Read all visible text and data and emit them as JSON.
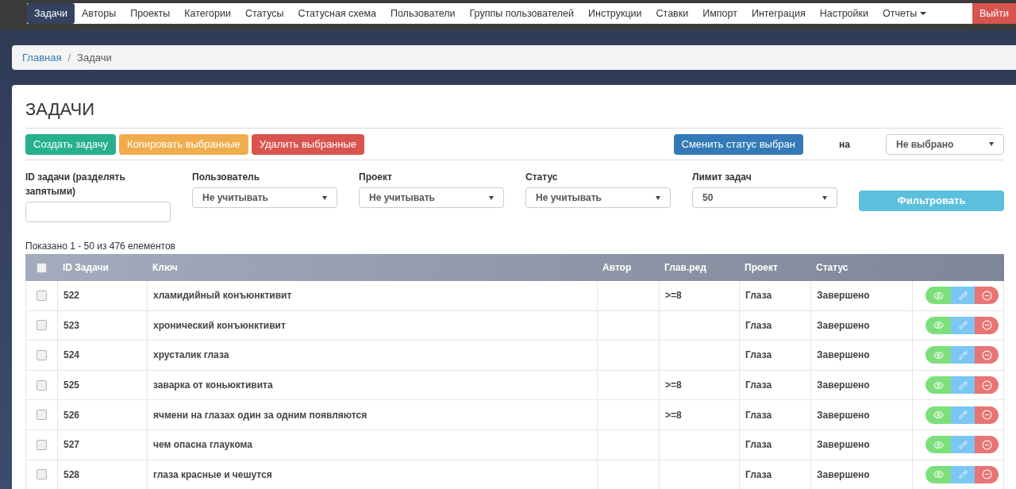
{
  "nav": {
    "items": [
      {
        "label": "Задачи",
        "selected": true,
        "kind": "link"
      },
      {
        "label": "Авторы",
        "selected": false,
        "kind": "link"
      },
      {
        "label": "Проекты",
        "selected": false,
        "kind": "link"
      },
      {
        "label": "Категории",
        "selected": false,
        "kind": "link"
      },
      {
        "label": "Статусы",
        "selected": false,
        "kind": "link"
      },
      {
        "label": "Статусная схема",
        "selected": false,
        "kind": "link"
      },
      {
        "label": "Пользователи",
        "selected": false,
        "kind": "link"
      },
      {
        "label": "Группы пользователей",
        "selected": false,
        "kind": "link"
      },
      {
        "label": "Инструкции",
        "selected": false,
        "kind": "link"
      },
      {
        "label": "Ставки",
        "selected": false,
        "kind": "link"
      },
      {
        "label": "Импорт",
        "selected": false,
        "kind": "link"
      },
      {
        "label": "Интеграция",
        "selected": false,
        "kind": "link"
      },
      {
        "label": "Настройки",
        "selected": false,
        "kind": "link"
      },
      {
        "label": "Отчеты",
        "selected": false,
        "kind": "dropdown"
      }
    ],
    "logout": "Выйти"
  },
  "breadcrumb": [
    "Главная",
    "/",
    "Задачи"
  ],
  "page_title": "ЗАДАЧИ",
  "actions": {
    "create": "Создать задачу",
    "copy": "Копировать выбранные",
    "delete": "Удалить выбранные",
    "change_status": "Сменить статус выбран",
    "to_label": "на",
    "status_select": "Не выбрано"
  },
  "filters": [
    {
      "label": "ID задачи (разделять запятыми)",
      "kind": "text"
    },
    {
      "label": "Пользователь",
      "kind": "select",
      "value": "Не учитывать"
    },
    {
      "label": "Проект",
      "kind": "select",
      "value": "Не учитывать"
    },
    {
      "label": "Статус",
      "kind": "select",
      "value": "Не учитывать"
    },
    {
      "label": "Лимит задач",
      "kind": "select",
      "value": "50"
    }
  ],
  "filter_button": "Фильтровать",
  "summary": "Показано 1 - 50 из 476 елементов",
  "table": {
    "select_all_checked": false,
    "columns": [
      "ID Задачи",
      "Ключ",
      "Автор",
      "Глав.ред",
      "Проект",
      "Статус"
    ],
    "rows": [
      {
        "checked": false,
        "id": "522",
        "key": "хламидийный конъюнктивит",
        "editor": ">=8",
        "project": "Глаза",
        "status": "Завершено"
      },
      {
        "checked": false,
        "id": "523",
        "key": "хронический конъюнктивит",
        "project": "Глаза",
        "status": "Завершено"
      },
      {
        "checked": false,
        "id": "524",
        "key": "хрусталик глаза",
        "project": "Глаза",
        "status": "Завершено"
      },
      {
        "checked": false,
        "id": "525",
        "key": "заварка от коньюктивита",
        "editor": ">=8",
        "project": "Глаза",
        "status": "Завершено"
      },
      {
        "checked": false,
        "id": "526",
        "key": "ячмени на глазах один за одним появляются",
        "editor": ">=8",
        "project": "Глаза",
        "status": "Завершено"
      },
      {
        "checked": false,
        "id": "527",
        "key": "чем опасна глаукома",
        "project": "Глаза",
        "status": "Завершено"
      },
      {
        "checked": false,
        "id": "528",
        "key": "глаза красные и чешутся",
        "project": "Глаза",
        "status": "Завершено"
      }
    ]
  }
}
